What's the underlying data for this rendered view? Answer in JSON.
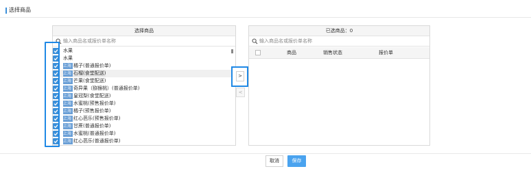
{
  "page": {
    "title": "选择商品"
  },
  "left_panel": {
    "title": "选择商品",
    "search_placeholder": "输入商品名或报价单名称",
    "items": [
      {
        "tag": "",
        "text": "水果"
      },
      {
        "tag": "",
        "text": "水果"
      },
      {
        "tag": "上海",
        "text": "橘子(普通报价单)"
      },
      {
        "tag": "上海",
        "text": "石榴(食堂配送)"
      },
      {
        "tag": "上海",
        "text": "芒果(食堂配送)"
      },
      {
        "tag": "上海",
        "text": "奇异果（猕猴桃）(普通报价单)"
      },
      {
        "tag": "上海",
        "text": "皇冠梨(食堂配送)"
      },
      {
        "tag": "上海",
        "text": "水蜜桃(预售报价单)"
      },
      {
        "tag": "上海",
        "text": "橘子(预售报价单)"
      },
      {
        "tag": "上海",
        "text": "红心芭乐(预售报价单)"
      },
      {
        "tag": "上海",
        "text": "甘蔗(普通报价单)"
      },
      {
        "tag": "上海",
        "text": "水蜜桃(普通报价单)"
      },
      {
        "tag": "上海",
        "text": "红心芭乐(普通报价单)"
      }
    ]
  },
  "transfer": {
    "move_right": ">",
    "move_left": "<"
  },
  "right_panel": {
    "title": "已选商品：0",
    "search_placeholder": "输入商品名或报价单名称",
    "columns": [
      "商品",
      "销售状态",
      "报价单"
    ]
  },
  "footer": {
    "cancel": "取消",
    "save": "保存"
  },
  "colors": {
    "accent": "#3b8fd9",
    "highlight": "#1e88e5",
    "save": "#4aa3ef"
  }
}
